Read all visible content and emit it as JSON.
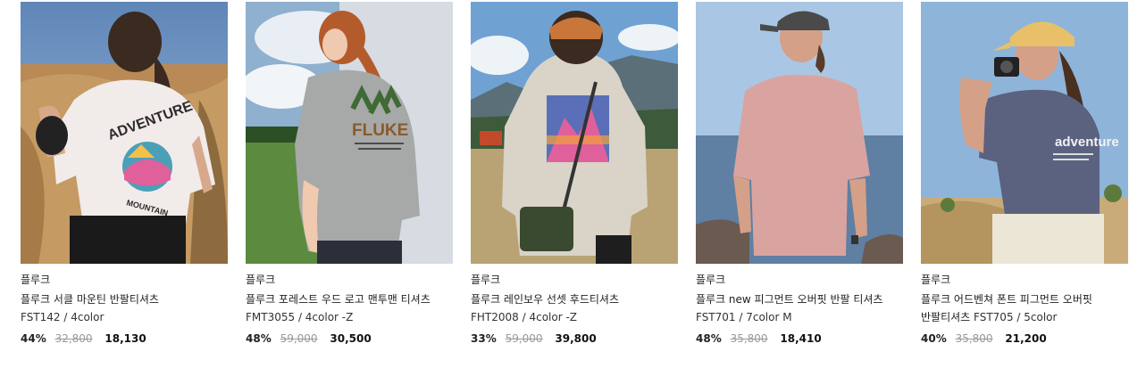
{
  "products": [
    {
      "brand": "플루크",
      "title": "플루크 서클 마운틴 반팔티셔츠",
      "code": "FST142 / 4color",
      "discount": "44%",
      "original_price": "32,800",
      "sale_price": "18,130",
      "image_icon": "model-white-tshirt-photo",
      "shirt_print": [
        "ADVENTURE",
        "MOUNTAIN"
      ]
    },
    {
      "brand": "플루크",
      "title": "플루크 포레스트 우드 로고 맨투맨 티셔츠",
      "code": "FMT3055 / 4color -Z",
      "discount": "48%",
      "original_price": "59,000",
      "sale_price": "30,500",
      "image_icon": "model-grey-sweatshirt-photo",
      "shirt_print": [
        "FLUKE"
      ]
    },
    {
      "brand": "플루크",
      "title": "플루크 레인보우 선셋 후드티셔츠",
      "code": "FHT2008 / 4color -Z",
      "discount": "33%",
      "original_price": "59,000",
      "sale_price": "39,800",
      "image_icon": "model-hoodie-back-photo",
      "shirt_print": []
    },
    {
      "brand": "플루크",
      "title": "플루크 new 피그먼트 오버핏 반팔 티셔츠",
      "code": "FST701 / 7color M",
      "discount": "48%",
      "original_price": "35,800",
      "sale_price": "18,410",
      "image_icon": "model-pink-tshirt-photo",
      "shirt_print": []
    },
    {
      "brand": "플루크",
      "title": "플루크 어드벤쳐 폰트 피그먼트 오버핏 반팔티셔츠",
      "code": "FST705 / 5color",
      "discount": "40%",
      "original_price": "35,800",
      "sale_price": "21,200",
      "image_icon": "model-navy-tshirt-camera-photo",
      "shirt_print": [
        "adventure"
      ]
    }
  ]
}
